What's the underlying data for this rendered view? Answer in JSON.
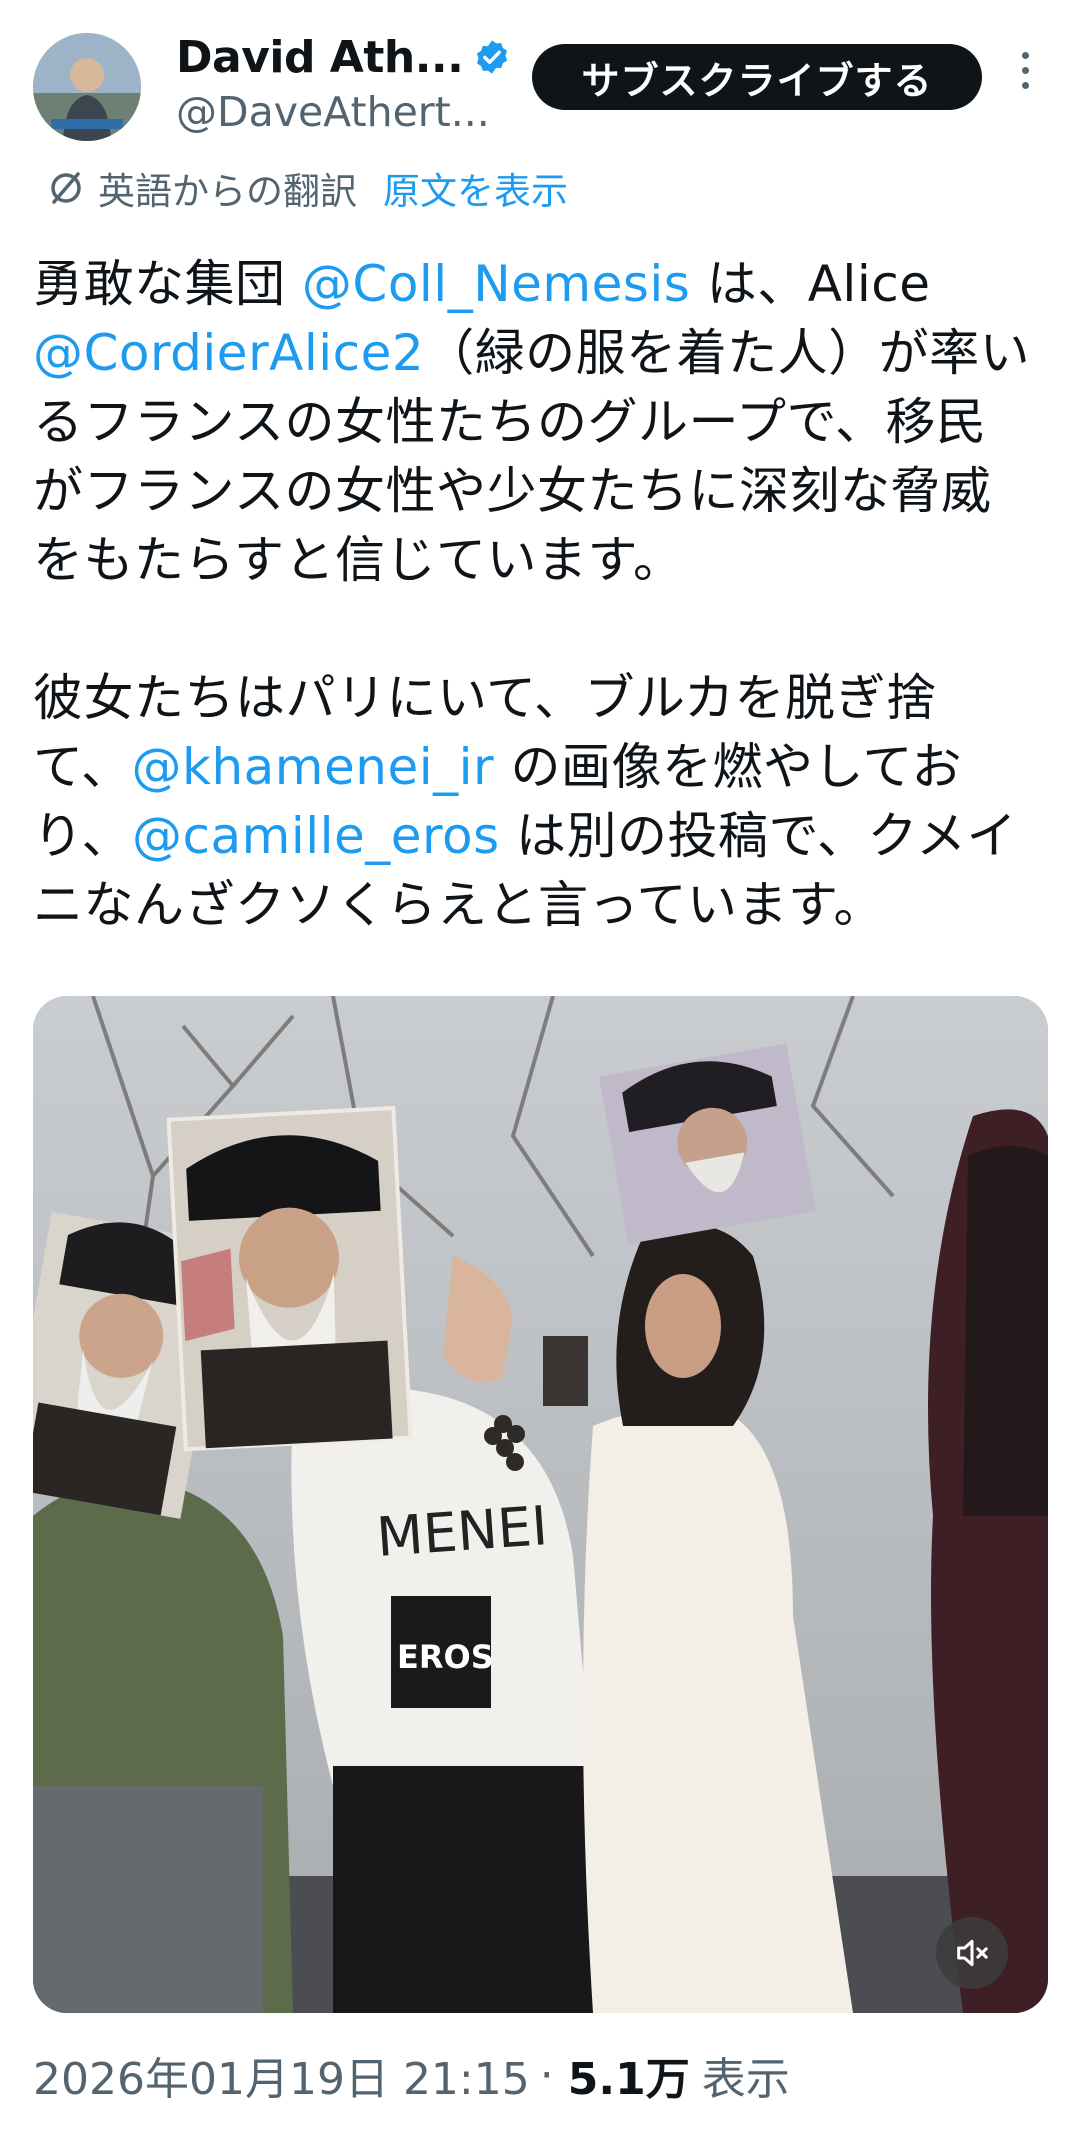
{
  "header": {
    "display_name": "David Ath...",
    "handle": "@DaveAthert...",
    "subscribe_label": "サブスクライブする",
    "avatar_icon": "user-avatar",
    "verified_icon": "verified-badge-icon",
    "more_icon": "more-vertical-icon"
  },
  "translation": {
    "label": "英語からの翻訳",
    "show_original": "原文を表示",
    "icon": "translate-icon"
  },
  "tweet": {
    "p1": [
      {
        "t": "勇敢な集団 ",
        "m": false
      },
      {
        "t": "@Coll_Nemesis",
        "m": true
      },
      {
        "t": " は、Alice ",
        "m": false
      },
      {
        "t": "@CordierAlice2",
        "m": true
      },
      {
        "t": "（緑の服を着た人）が率いるフランスの女性たちのグループで、移民がフランスの女性や少女たちに深刻な脅威をもたらすと信じています。",
        "m": false
      }
    ],
    "p2": [
      {
        "t": "彼女たちはパリにいて、ブルカを脱ぎ捨て、",
        "m": false
      },
      {
        "t": "@khamenei_ir",
        "m": true
      },
      {
        "t": " の画像を燃やしており、",
        "m": false
      },
      {
        "t": "@camille_eros",
        "m": true
      },
      {
        "t": " は別の投稿で、クメイニなんざクソくらえと言っています。",
        "m": false
      }
    ]
  },
  "media": {
    "shirt_text": "MENEI",
    "shirt_logo": "EROS",
    "mute_icon": "volume-mute-icon"
  },
  "meta": {
    "timestamp": "2026年01月19日 21:15",
    "separator": "·",
    "views_count": "5.1万",
    "views_label": "表示"
  },
  "colors": {
    "accent": "#1d9bf0",
    "text": "#0f1419",
    "secondary": "#536471",
    "button_bg": "#0f1419"
  }
}
